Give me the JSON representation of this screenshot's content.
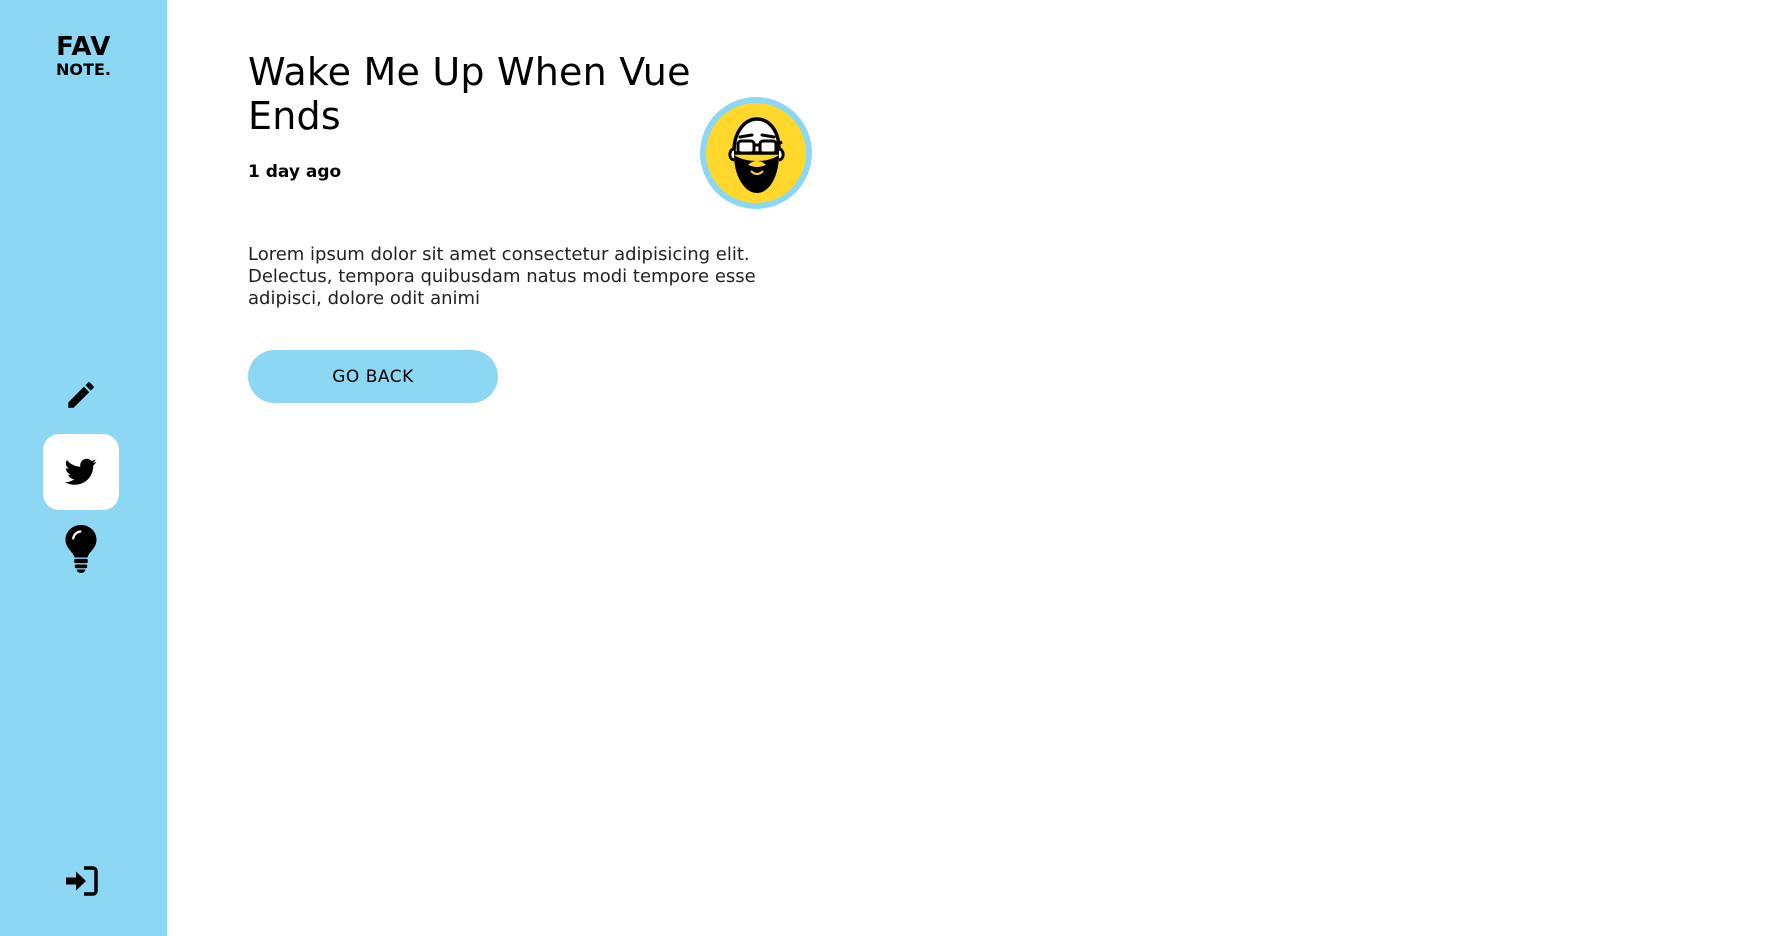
{
  "sidebar": {
    "logo": {
      "line1": "FAV",
      "line2": "NOTE."
    },
    "items": [
      {
        "icon": "pencil-icon",
        "active": false
      },
      {
        "icon": "twitter-icon",
        "active": true
      },
      {
        "icon": "lightbulb-icon",
        "active": false
      }
    ],
    "logout_icon": "logout-icon"
  },
  "note": {
    "title": "Wake Me Up When Vue Ends",
    "date": "1 day ago",
    "body": "Lorem ipsum dolor sit amet consectetur adipisicing elit. Delectus, tempora quibusdam natus modi tempore esse adipisci, dolore odit animi",
    "button_label": "GO BACK"
  },
  "colors": {
    "accent": "#8cd7f4",
    "avatar_bg": "#ffd82b"
  }
}
